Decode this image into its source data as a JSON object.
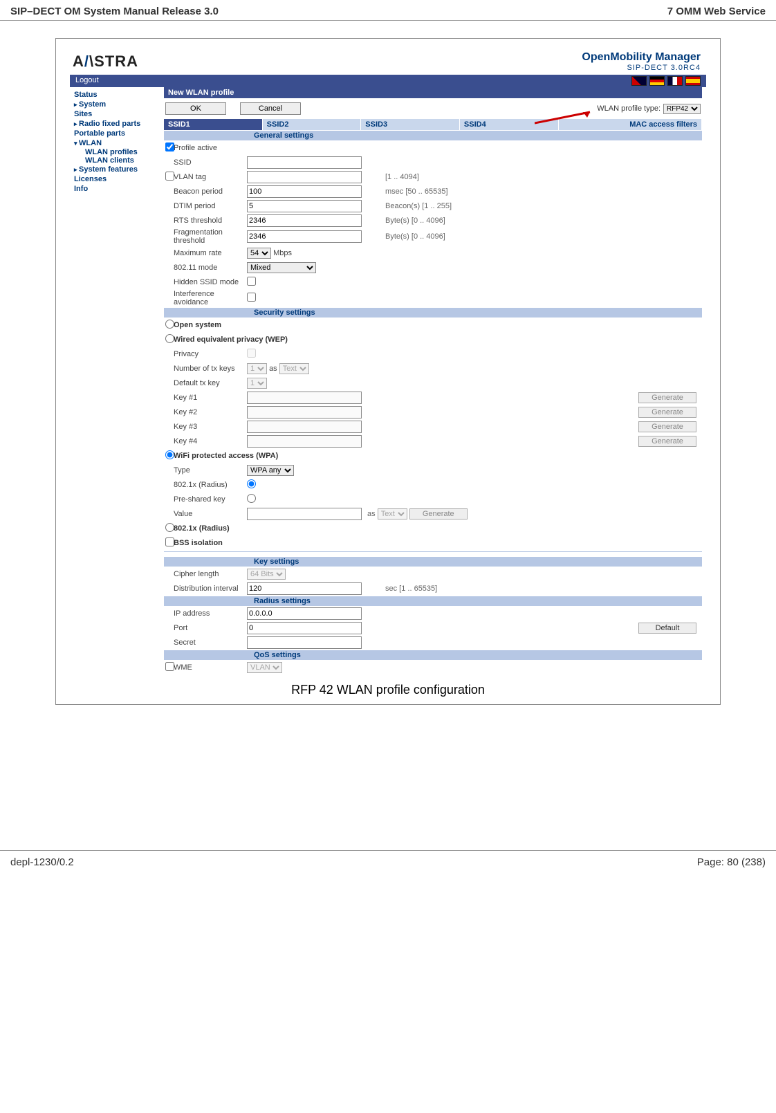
{
  "doc_header_left": "SIP–DECT OM System Manual Release 3.0",
  "doc_header_right": "7 OMM Web Service",
  "doc_footer_left": "depl-1230/0.2",
  "doc_footer_right": "Page: 80 (238)",
  "logo_text": "AASTRA",
  "brand_title": "OpenMobility Manager",
  "brand_sub": "SIP-DECT 3.0RC4",
  "logout_label": "Logout",
  "sidebar": {
    "status": "Status",
    "system": "System",
    "sites": "Sites",
    "radio_fixed_parts": "Radio fixed parts",
    "portable_parts": "Portable parts",
    "wlan": "WLAN",
    "wlan_profiles": "WLAN profiles",
    "wlan_clients": "WLAN clients",
    "system_features": "System features",
    "licenses": "Licenses",
    "info": "Info"
  },
  "panel_title": "New WLAN profile",
  "ok_label": "OK",
  "cancel_label": "Cancel",
  "profile_type_label": "WLAN profile type:",
  "profile_type_value": "RFP42",
  "tabs": {
    "ssid1": "SSID1",
    "ssid2": "SSID2",
    "ssid3": "SSID3",
    "ssid4": "SSID4",
    "mac": "MAC access filters"
  },
  "sections": {
    "general": "General settings",
    "security": "Security settings",
    "key": "Key settings",
    "radius": "Radius settings",
    "qos": "QoS settings"
  },
  "general": {
    "profile_active_label": "Profile active",
    "ssid_label": "SSID",
    "vlan_tag_label": "VLAN tag",
    "vlan_tag_hint": "[1 .. 4094]",
    "beacon_period_label": "Beacon period",
    "beacon_period_value": "100",
    "beacon_period_hint": "msec [50 .. 65535]",
    "dtim_period_label": "DTIM period",
    "dtim_period_value": "5",
    "dtim_period_hint": "Beacon(s) [1 .. 255]",
    "rts_threshold_label": "RTS threshold",
    "rts_threshold_value": "2346",
    "rts_threshold_hint": "Byte(s) [0 .. 4096]",
    "frag_threshold_label": "Fragmentation threshold",
    "frag_threshold_value": "2346",
    "frag_threshold_hint": "Byte(s) [0 .. 4096]",
    "max_rate_label": "Maximum rate",
    "max_rate_value": "54",
    "max_rate_unit": "Mbps",
    "mode_label": "802.11 mode",
    "mode_value": "Mixed",
    "hidden_ssid_label": "Hidden SSID mode",
    "interference_label": "Interference avoidance"
  },
  "security": {
    "open_system_label": "Open system",
    "wep_label": "Wired equivalent privacy (WEP)",
    "privacy_label": "Privacy",
    "num_tx_keys_label": "Number of tx keys",
    "num_tx_keys_value": "1",
    "num_tx_as": "as",
    "num_tx_type": "Text",
    "default_tx_key_label": "Default tx key",
    "default_tx_key_value": "1",
    "key1_label": "Key #1",
    "key2_label": "Key #2",
    "key3_label": "Key #3",
    "key4_label": "Key #4",
    "generate_label": "Generate",
    "wpa_label": "WiFi protected access (WPA)",
    "wpa_type_label": "Type",
    "wpa_type_value": "WPA any",
    "wpa_radius_label": "802.1x (Radius)",
    "psk_label": "Pre-shared key",
    "value_label": "Value",
    "value_as": "as",
    "value_type": "Text",
    "radius_only_label": "802.1x (Radius)",
    "bss_isolation_label": "BSS isolation"
  },
  "key": {
    "cipher_label": "Cipher length",
    "cipher_value": "64 Bits",
    "dist_interval_label": "Distribution interval",
    "dist_interval_value": "120",
    "dist_interval_hint": "sec [1 .. 65535]"
  },
  "radius": {
    "ip_label": "IP address",
    "ip_value": "0.0.0.0",
    "port_label": "Port",
    "port_value": "0",
    "default_label": "Default",
    "secret_label": "Secret"
  },
  "qos": {
    "wme_label": "WME",
    "wme_value": "VLAN"
  },
  "caption": "RFP 42 WLAN profile configuration"
}
